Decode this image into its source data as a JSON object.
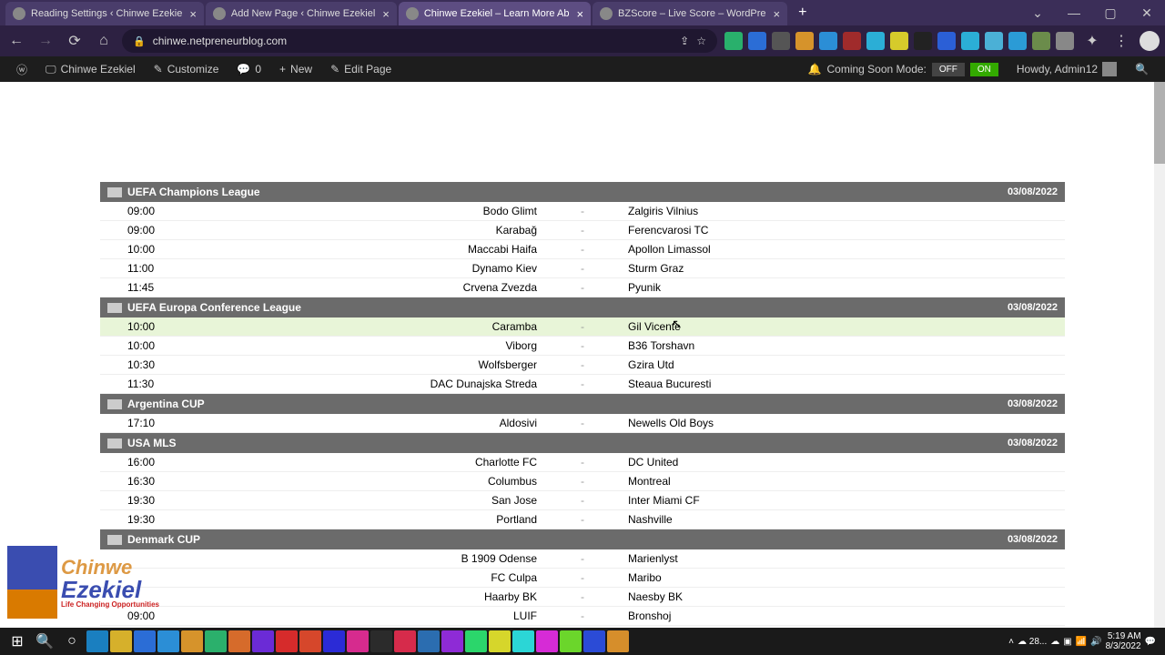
{
  "browser": {
    "tabs": [
      {
        "label": "Reading Settings ‹ Chinwe Ezekie"
      },
      {
        "label": "Add New Page ‹ Chinwe Ezekiel"
      },
      {
        "label": "Chinwe Ezekiel – Learn More Ab"
      },
      {
        "label": "BZScore – Live Score – WordPre"
      }
    ],
    "url": "chinwe.netpreneurblog.com"
  },
  "wp": {
    "site": "Chinwe Ezekiel",
    "customize": "Customize",
    "comments": "0",
    "new": "New",
    "edit": "Edit Page",
    "coming_soon": "Coming Soon Mode:",
    "off": "OFF",
    "on": "ON",
    "howdy": "Howdy, Admin12"
  },
  "leagues": [
    {
      "name": "UEFA Champions League",
      "date": "03/08/2022",
      "matches": [
        {
          "time": "09:00",
          "home": "Bodo Glimt",
          "away": "Zalgiris Vilnius"
        },
        {
          "time": "09:00",
          "home": "Karabağ",
          "away": "Ferencvarosi TC"
        },
        {
          "time": "10:00",
          "home": "Maccabi Haifa",
          "away": "Apollon Limassol"
        },
        {
          "time": "11:00",
          "home": "Dynamo Kiev",
          "away": "Sturm Graz"
        },
        {
          "time": "11:45",
          "home": "Crvena Zvezda",
          "away": "Pyunik"
        }
      ]
    },
    {
      "name": "UEFA Europa Conference League",
      "date": "03/08/2022",
      "matches": [
        {
          "time": "10:00",
          "home": "Caramba",
          "away": "Gil Vicente",
          "highlight": true
        },
        {
          "time": "10:00",
          "home": "Viborg",
          "away": "B36 Torshavn"
        },
        {
          "time": "10:30",
          "home": "Wolfsberger",
          "away": "Gzira Utd"
        },
        {
          "time": "11:30",
          "home": "DAC Dunajska Streda",
          "away": "Steaua Bucuresti"
        }
      ]
    },
    {
      "name": "Argentina CUP",
      "date": "03/08/2022",
      "matches": [
        {
          "time": "17:10",
          "home": "Aldosivi",
          "away": "Newells Old Boys"
        }
      ]
    },
    {
      "name": "USA MLS",
      "date": "03/08/2022",
      "matches": [
        {
          "time": "16:00",
          "home": "Charlotte FC",
          "away": "DC United"
        },
        {
          "time": "16:30",
          "home": "Columbus",
          "away": "Montreal"
        },
        {
          "time": "19:30",
          "home": "San Jose",
          "away": "Inter Miami CF"
        },
        {
          "time": "19:30",
          "home": "Portland",
          "away": "Nashville"
        }
      ]
    },
    {
      "name": "Denmark CUP",
      "date": "03/08/2022",
      "matches": [
        {
          "time": "",
          "home": "B 1909 Odense",
          "away": "Marienlyst"
        },
        {
          "time": "",
          "home": "FC Culpa",
          "away": "Maribo"
        },
        {
          "time": "",
          "home": "Haarby BK",
          "away": "Naesby BK"
        },
        {
          "time": "09:00",
          "home": "LUIF",
          "away": "Bronshoj"
        }
      ]
    }
  ],
  "logo": {
    "l1": "Chinwe",
    "l2": "Ezekiel",
    "l3": "Life Changing Opportunities"
  },
  "taskbar": {
    "temp": "28...",
    "time": "5:19 AM",
    "date": "8/3/2022"
  },
  "ext_colors": [
    "#29b06c",
    "#2b6dd6",
    "#555",
    "#d6932b",
    "#2b8ed6",
    "#a02b2b",
    "#2baed6",
    "#d6cb2b",
    "#222",
    "#2b5fd6",
    "#2baed6",
    "#4bb0d6",
    "#2b9bd6",
    "#6b8c4b",
    "#888"
  ],
  "tb_colors": [
    "#1a7fc0",
    "#d6b02b",
    "#2b6dd6",
    "#2b8ed6",
    "#d6932b",
    "#2bb06c",
    "#d66b2b",
    "#6b2bd6",
    "#d62b2b",
    "#d6472b",
    "#2b2bd6",
    "#d62b8e",
    "#2b2b2b",
    "#d62b4b",
    "#2b6db0",
    "#8e2bd6",
    "#2bd66b",
    "#d6d62b",
    "#2bd6d6",
    "#d62bd6",
    "#6bd62b",
    "#2b4bd6",
    "#d68e2b"
  ]
}
